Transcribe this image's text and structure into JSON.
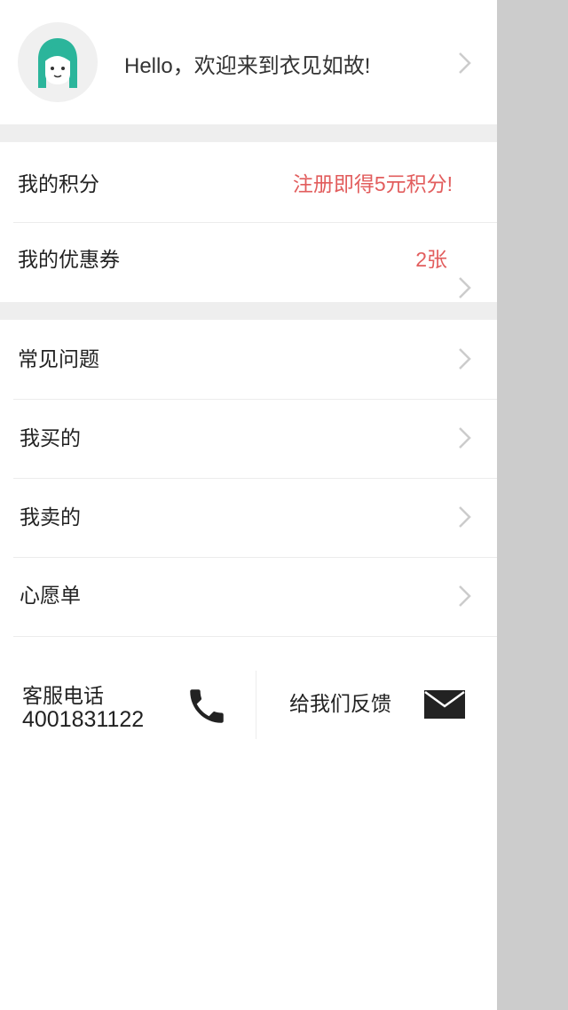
{
  "profile": {
    "greeting": "Hello，欢迎来到衣见如故!"
  },
  "account": {
    "points": {
      "label": "我的积分",
      "value": "注册即得5元积分!"
    },
    "coupons": {
      "label": "我的优惠券",
      "value": "2张"
    }
  },
  "menu": [
    {
      "label": "常见问题"
    },
    {
      "label": "我买的"
    },
    {
      "label": "我卖的"
    },
    {
      "label": "心愿单"
    }
  ],
  "contact": {
    "service_label": "客服电话",
    "service_phone": "4001831122",
    "feedback_label": "给我们反馈"
  },
  "colors": {
    "accent_red": "#e25d5d",
    "avatar_teal": "#2bb59b",
    "background_gray": "#cccccc",
    "section_gap": "#eeeeee"
  },
  "icons": {
    "avatar": "girl-avatar-icon",
    "chevron": "chevron-right-icon",
    "phone": "phone-icon",
    "mail": "mail-icon"
  }
}
